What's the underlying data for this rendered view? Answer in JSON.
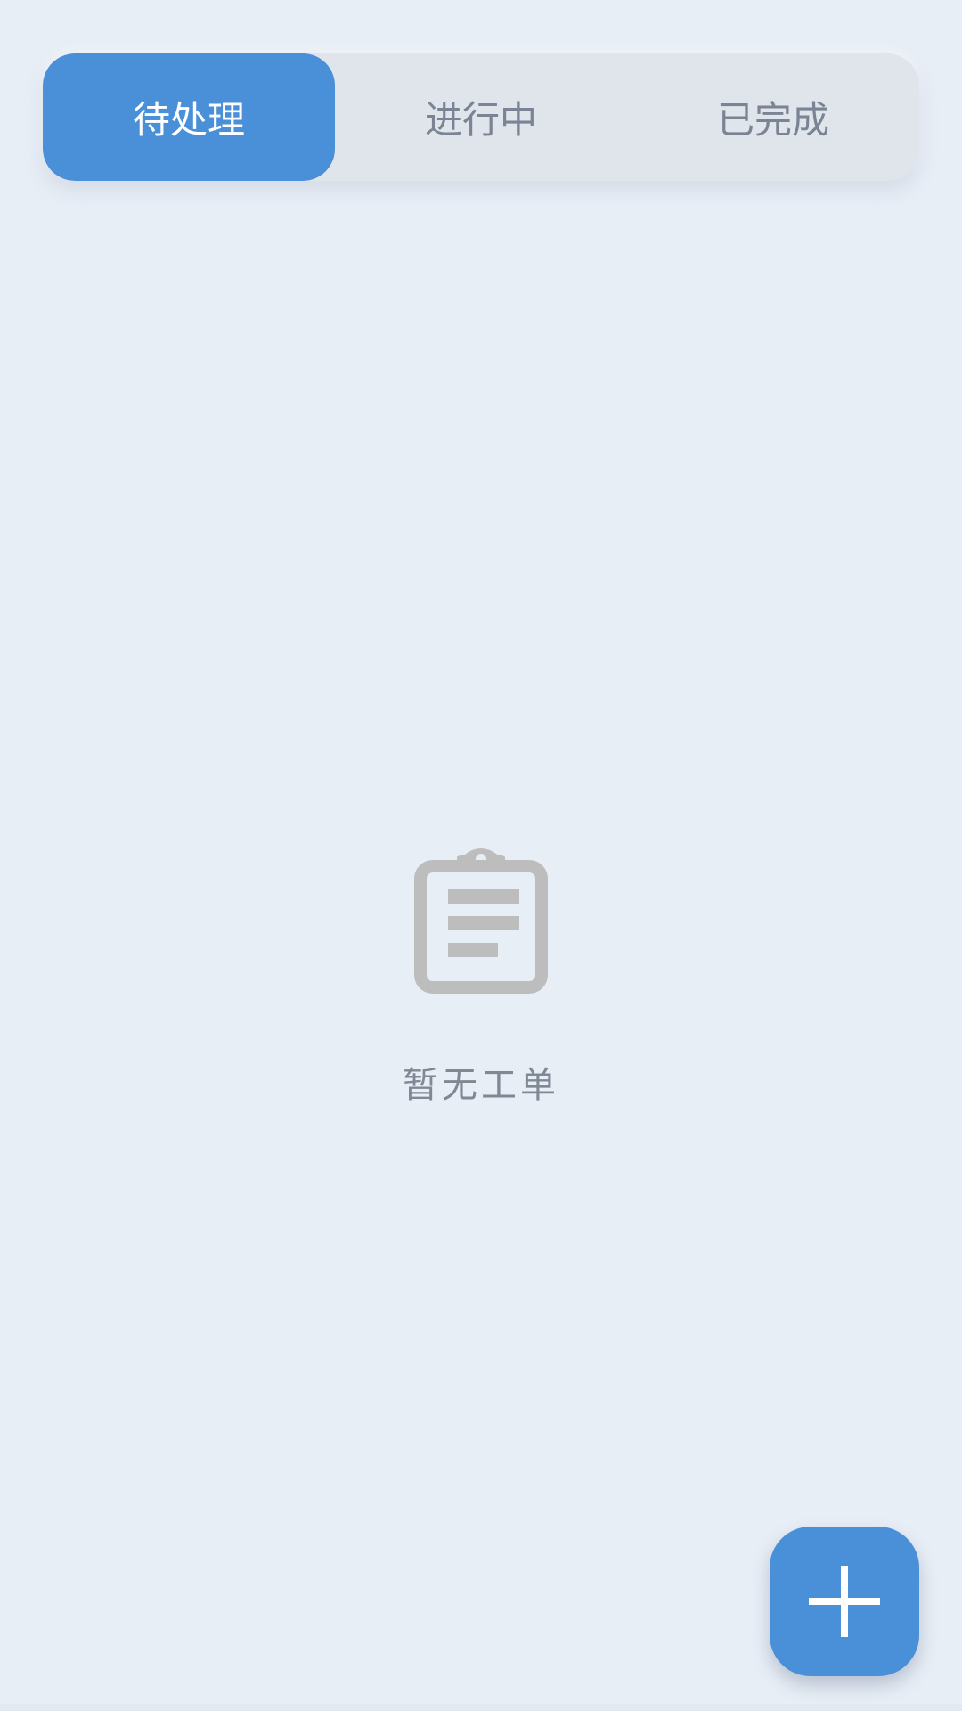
{
  "tabs": {
    "items": [
      {
        "label": "待处理",
        "active": true
      },
      {
        "label": "进行中",
        "active": false
      },
      {
        "label": "已完成",
        "active": false
      }
    ]
  },
  "empty_state": {
    "icon": "clipboard-icon",
    "message": "暂无工单"
  },
  "fab": {
    "icon": "plus-icon"
  },
  "colors": {
    "accent": "#4a90d9",
    "background": "#e8eef6",
    "tabbar_bg": "#e0e5ec",
    "inactive_text": "#7a8494",
    "empty_icon": "#bdbdbd",
    "empty_text": "#7f8894"
  }
}
